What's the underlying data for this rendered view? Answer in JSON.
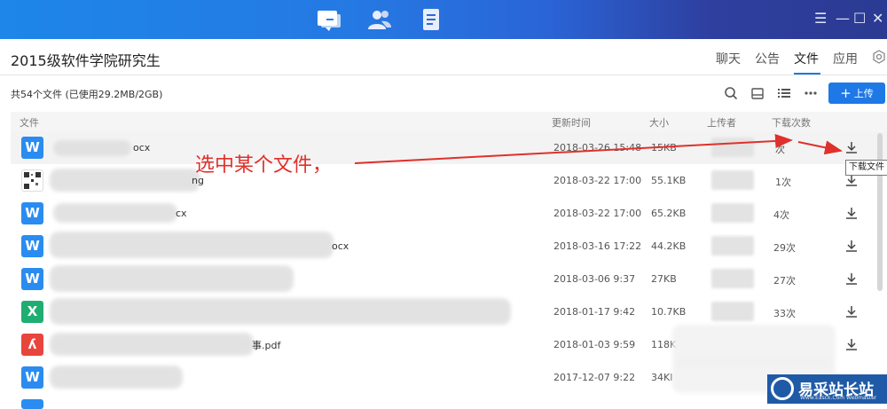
{
  "titlebar": {
    "tabs": [
      {
        "icon": "chat-icon",
        "active": true
      },
      {
        "icon": "contacts-icon",
        "active": false
      },
      {
        "icon": "document-icon",
        "active": false
      }
    ],
    "controls": {
      "menu": "☰",
      "minimize": "—",
      "maximize": "☐",
      "close": "✕"
    }
  },
  "header": {
    "group_title": "2015级软件学院研究生",
    "nav": [
      "聊天",
      "公告",
      "文件",
      "应用"
    ],
    "active_nav": "文件"
  },
  "toolbar": {
    "file_count": "共54个文件 (已使用29.2MB/2GB)",
    "upload_label": "上传"
  },
  "columns": {
    "name": "文件",
    "updated": "更新时间",
    "size": "大小",
    "uploader": "上传者",
    "downloads": "下载次数"
  },
  "files": [
    {
      "type": "word",
      "name_suffix": "ocx",
      "date": "2018-03-26 15:48",
      "size": "15KB",
      "count": "次"
    },
    {
      "type": "image",
      "name_suffix": "ng",
      "date": "2018-03-22 17:00",
      "size": "55.1KB",
      "count": "1次"
    },
    {
      "type": "word",
      "name_suffix": "cx",
      "date": "2018-03-22 17:00",
      "size": "65.2KB",
      "count": "4次"
    },
    {
      "type": "word",
      "name_suffix": "ocx",
      "date": "2018-03-16 17:22",
      "size": "44.2KB",
      "count": "29次"
    },
    {
      "type": "word",
      "name_suffix": "",
      "date": "2018-03-06 9:37",
      "size": "27KB",
      "count": "27次"
    },
    {
      "type": "excel",
      "name_suffix": "",
      "date": "2018-01-17 9:42",
      "size": "10.7KB",
      "count": "33次"
    },
    {
      "type": "pdf",
      "name_suffix": "事.pdf",
      "date": "2018-01-03 9:59",
      "size": "118K",
      "count": ""
    },
    {
      "type": "word",
      "name_suffix": "",
      "date": "2017-12-07 9:22",
      "size": "34KI",
      "count": ""
    }
  ],
  "tooltip": "下载文件",
  "annotation": "选中某个文件，",
  "watermark": {
    "title": "易采站长站",
    "subtitle": "Www.Easck.Com Webmaster"
  },
  "colors": {
    "accent": "#1e78e6",
    "annotation": "#e0302b",
    "word": "#2a8cf0",
    "excel": "#1fae72",
    "pdf": "#e8453c"
  }
}
